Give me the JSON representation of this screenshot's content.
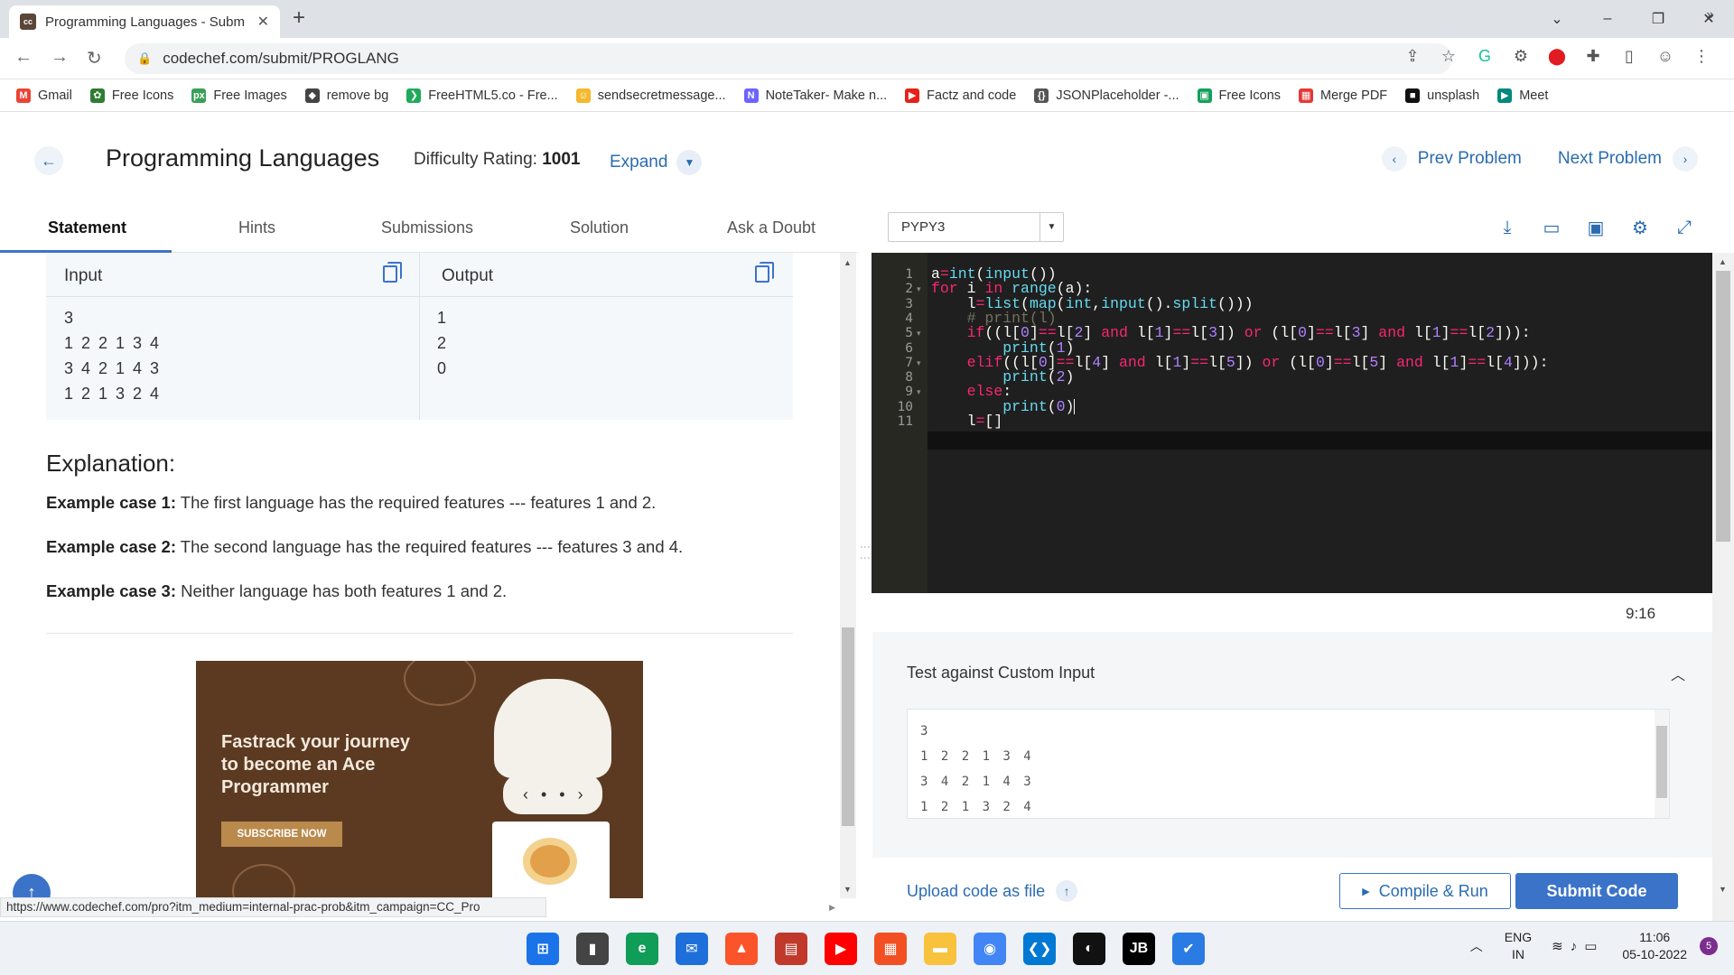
{
  "browser": {
    "tab_title": "Programming Languages - Subm",
    "favicon_text": "cc",
    "url": "codechef.com/submit/PROGLANG",
    "bookmarks": [
      {
        "label": "Gmail",
        "color": "#ea4335",
        "glyph": "M"
      },
      {
        "label": "Free Icons",
        "color": "#2e7d32",
        "glyph": "✿"
      },
      {
        "label": "Free Images",
        "color": "#3a9f57",
        "glyph": "px"
      },
      {
        "label": "remove bg",
        "color": "#444444",
        "glyph": "◆"
      },
      {
        "label": "FreeHTML5.co - Fre...",
        "color": "#1faa5b",
        "glyph": "❯"
      },
      {
        "label": "sendsecretmessage...",
        "color": "#f5b82e",
        "glyph": "☺"
      },
      {
        "label": "NoteTaker- Make n...",
        "color": "#6c63ff",
        "glyph": "N"
      },
      {
        "label": "Factz and code",
        "color": "#e62117",
        "glyph": "▶"
      },
      {
        "label": "JSONPlaceholder -...",
        "color": "#555555",
        "glyph": "{}"
      },
      {
        "label": "Free Icons",
        "color": "#14a05a",
        "glyph": "▣"
      },
      {
        "label": "Merge PDF",
        "color": "#e53935",
        "glyph": "▦"
      },
      {
        "label": "unsplash",
        "color": "#111111",
        "glyph": "■"
      },
      {
        "label": "Meet",
        "color": "#00897b",
        "glyph": "▶"
      }
    ],
    "more_bookmarks": "»"
  },
  "header": {
    "title": "Programming Languages",
    "difficulty_label": "Difficulty Rating:",
    "difficulty_value": "1001",
    "expand_label": "Expand",
    "prev_label": "Prev Problem",
    "next_label": "Next Problem"
  },
  "tabs": [
    "Statement",
    "Hints",
    "Submissions",
    "Solution",
    "Ask a Doubt"
  ],
  "io": {
    "input_label": "Input",
    "output_label": "Output",
    "input_lines": [
      "3",
      "1 2 2 1 3 4",
      "3 4 2 1 4 3",
      "1 2 1 3 2 4"
    ],
    "output_lines": [
      "1",
      "2",
      "0"
    ]
  },
  "explanation": {
    "title": "Explanation:",
    "cases": [
      {
        "label": "Example case 1:",
        "text": " The first language has the required features --- features 1 and 2."
      },
      {
        "label": "Example case 2:",
        "text": " The second language has the required features --- features 3 and 4."
      },
      {
        "label": "Example case 3:",
        "text": " Neither language has both features 1 and 2."
      }
    ]
  },
  "ad": {
    "headline_1": "Fastrack your journey",
    "headline_2": "to become an Ace",
    "headline_3": "Programmer",
    "cta": "SUBSCRIBE NOW"
  },
  "status_url": "https://www.codechef.com/pro?itm_medium=internal-prac-prob&itm_campaign=CC_Pro",
  "editor": {
    "language": "PYPY3",
    "line_numbers": [
      "1",
      "2",
      "3",
      "4",
      "5",
      "6",
      "7",
      "8",
      "9",
      "10",
      "11"
    ],
    "cursor_position": "9:16",
    "code_lines": [
      "a=int(input())",
      "for i in range(a):",
      "    l=list(map(int,input().split()))",
      "    # print(l)",
      "    if((l[0]==l[2] and l[1]==l[3]) or (l[0]==l[3] and l[1]==l[2])):",
      "        print(1)",
      "    elif((l[0]==l[4] and l[1]==l[5]) or (l[0]==l[5] and l[1]==l[4])):",
      "        print(2)",
      "    else:",
      "        print(0)",
      "    l=[]"
    ]
  },
  "custom_input": {
    "title": "Test against Custom Input",
    "lines": [
      "3",
      "1 2 2 1 3 4",
      "3 4 2 1 4 3",
      "1 2 1 3 2 4"
    ]
  },
  "actions": {
    "upload_label": "Upload code as file",
    "compile_label": "Compile & Run",
    "submit_label": "Submit Code"
  },
  "taskbar": {
    "lang_1": "ENG",
    "lang_2": "IN",
    "time": "11:06",
    "date": "05-10-2022",
    "notifications": "5"
  }
}
